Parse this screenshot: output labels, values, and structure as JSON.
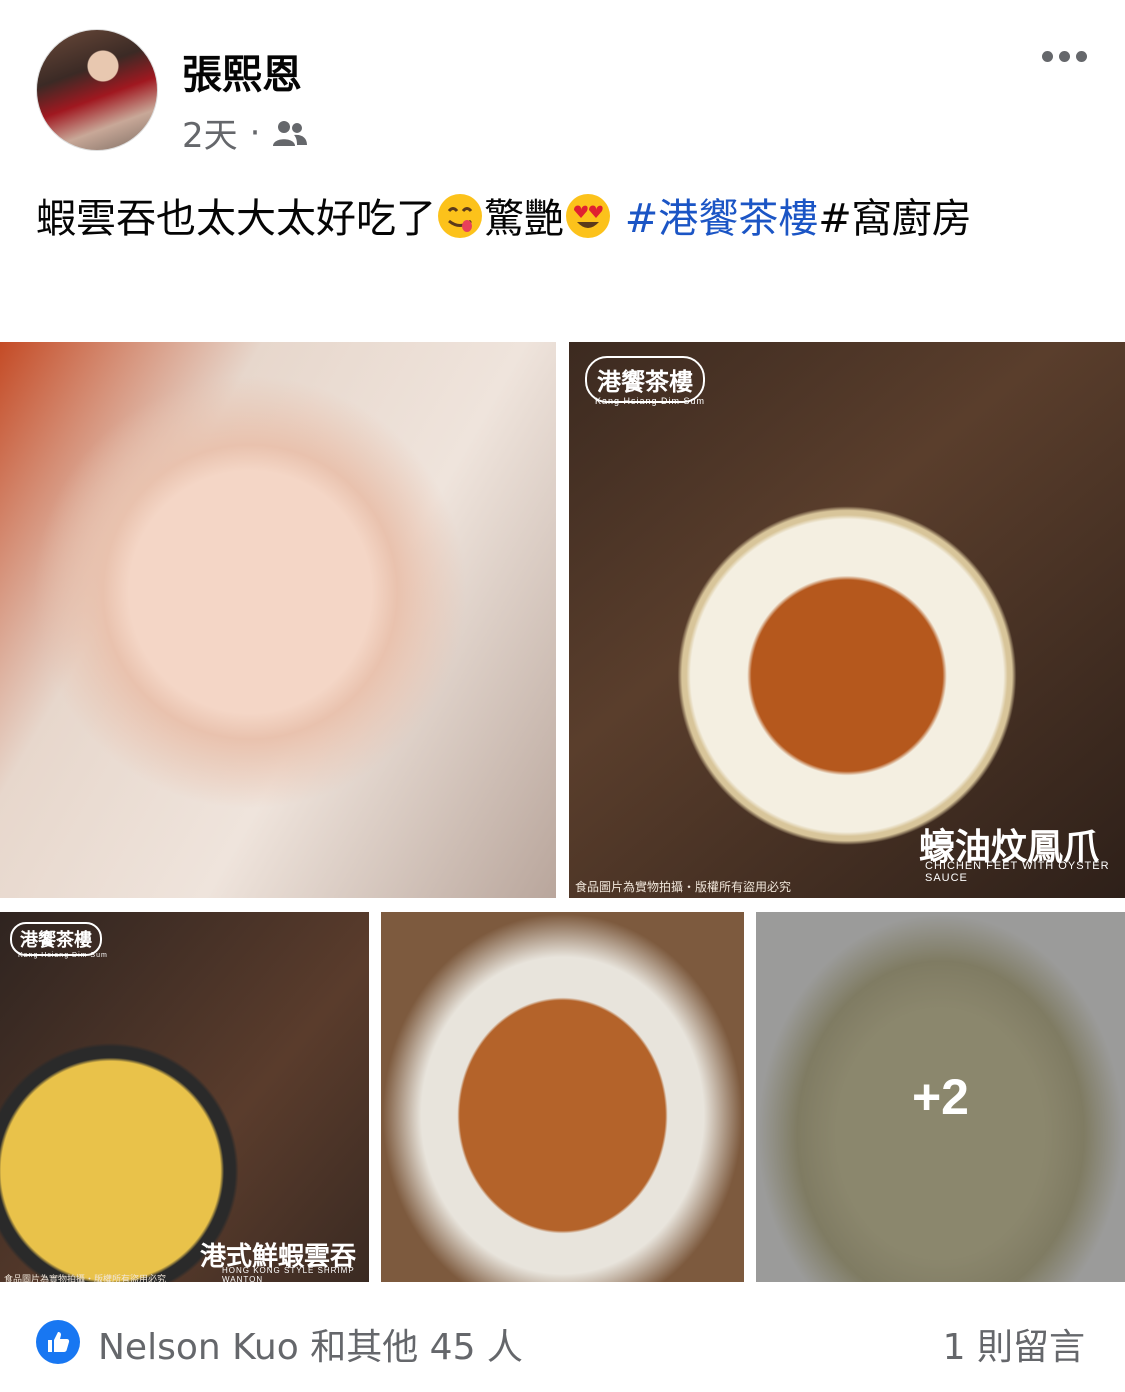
{
  "post": {
    "author": "張熙恩",
    "time": "2天",
    "separator": "·",
    "audience_icon": "friends-icon",
    "text_main": "蝦雲吞也太大太好吃了",
    "emoji1": "yum-face-emoji",
    "text_mid": "驚艷",
    "emoji2": "heart-eyes-emoji",
    "hashtag": "#港饗茶樓",
    "text_end": "#窩廚房"
  },
  "photos": {
    "p2_brand": "港饗茶樓",
    "p2_brand_en": "Kang Hsiang Dim Sum",
    "p2_caption": "蠔油炆鳳爪",
    "p2_caption_en": "CHICHEN FEET WITH OYSTER SAUCE",
    "p2_disclaimer": "食品圖片為實物拍攝・版權所有盜用必究",
    "p3_brand": "港饗茶樓",
    "p3_brand_en": "Kang Hsiang Dim Sum",
    "p3_caption": "港式鮮蝦雲吞",
    "p3_caption_en": "HONG KONG STYLE SHRIMP WANTON",
    "p3_disclaimer": "食品圖片為實物拍攝・版權所有盜用必究",
    "more_count": "+2"
  },
  "footer": {
    "likes_text": "Nelson Kuo 和其他 45 人",
    "comments_text": "1 則留言"
  },
  "colors": {
    "hashtag": "#1b55c5",
    "like_blue": "#1877f2",
    "secondary_text": "#65676b"
  }
}
